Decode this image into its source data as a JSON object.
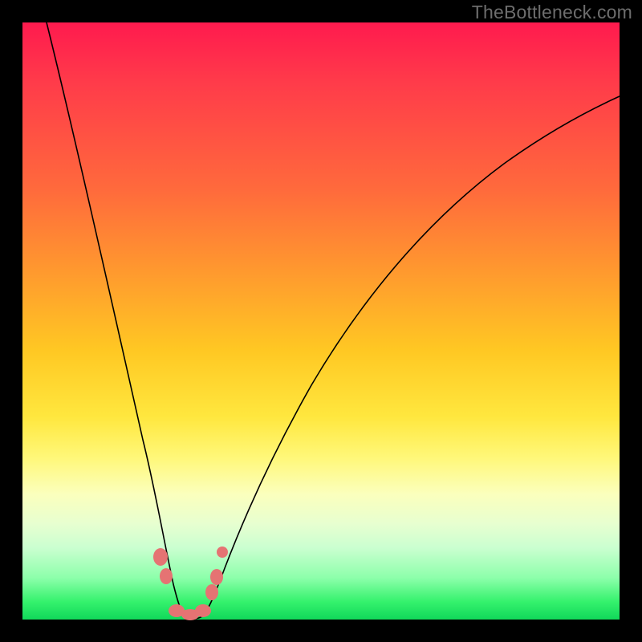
{
  "watermark": "TheBottleneck.com",
  "colors": {
    "page_bg": "#000000",
    "watermark_text": "#6d6d6d",
    "curve_stroke": "#000000",
    "marker_fill": "#e57373",
    "gradient": [
      "#ff1a4e",
      "#ff3b4a",
      "#ff6a3c",
      "#ff9a2e",
      "#ffc823",
      "#ffe73e",
      "#fff87a",
      "#fbffbd",
      "#e7ffd0",
      "#caffd0",
      "#8dffab",
      "#35f26d",
      "#11d85a"
    ]
  },
  "chart_data": {
    "type": "line",
    "title": "",
    "xlabel": "",
    "ylabel": "",
    "xlim": [
      0,
      100
    ],
    "ylim": [
      0,
      100
    ],
    "note": "Axes are unlabeled; values are normalized to plot area (0=left/bottom, 100=right/top). The curve is a V-shaped bottleneck curve whose minimum sits near x≈27, y≈0.",
    "series": [
      {
        "name": "bottleneck-curve",
        "x": [
          4,
          6,
          8,
          10,
          12,
          14,
          16,
          18,
          20,
          22,
          23.5,
          25,
          26,
          27,
          28,
          29,
          30,
          31,
          33,
          36,
          40,
          45,
          50,
          56,
          63,
          71,
          80,
          90,
          100
        ],
        "y": [
          100,
          90,
          80,
          70,
          60,
          50,
          41,
          32,
          23,
          15,
          10,
          5.5,
          2.8,
          0.8,
          0.4,
          0.6,
          1.2,
          2.5,
          6,
          12,
          20,
          30,
          39,
          48,
          57,
          65,
          72,
          78.5,
          84
        ]
      }
    ],
    "markers": [
      {
        "name": "left-upper-blob",
        "x": 23.3,
        "y": 10.2
      },
      {
        "name": "left-lower-blob",
        "x": 24.3,
        "y": 7.0
      },
      {
        "name": "trough-left",
        "x": 26.0,
        "y": 1.2
      },
      {
        "name": "trough-center",
        "x": 28.2,
        "y": 0.6
      },
      {
        "name": "trough-right",
        "x": 30.4,
        "y": 1.2
      },
      {
        "name": "right-blob-1",
        "x": 31.8,
        "y": 4.6
      },
      {
        "name": "right-blob-2",
        "x": 32.6,
        "y": 7.0
      },
      {
        "name": "right-upper-dot",
        "x": 33.6,
        "y": 11.4
      }
    ]
  }
}
